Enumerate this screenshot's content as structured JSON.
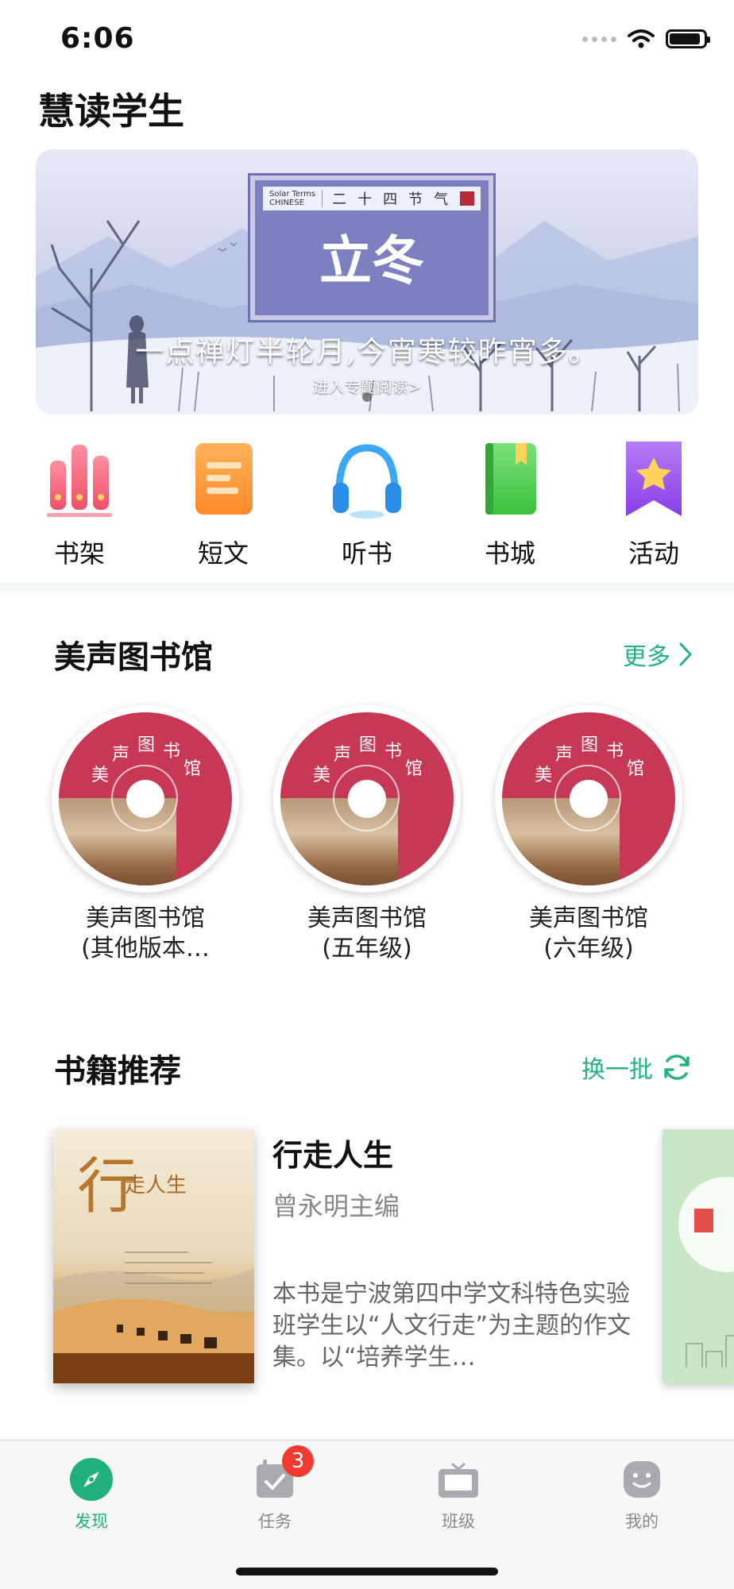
{
  "status_bar": {
    "time": "6:06"
  },
  "header": {
    "title": "慧读学生"
  },
  "banner": {
    "sign_en_line1": "Solar Terms",
    "sign_en_line2": "CHINESE",
    "sign_series": "二十四节气",
    "sign_title": "立冬",
    "poem": "一点禅灯半轮月,今宵寒较昨宵多。",
    "link": "进入专题阅读>"
  },
  "quick_nav": [
    {
      "label": "书架",
      "icon": "bookshelf-icon"
    },
    {
      "label": "短文",
      "icon": "article-icon"
    },
    {
      "label": "听书",
      "icon": "headphones-icon"
    },
    {
      "label": "书城",
      "icon": "bookstore-icon"
    },
    {
      "label": "活动",
      "icon": "activity-star-icon"
    }
  ],
  "library": {
    "title": "美声图书馆",
    "more": "更多",
    "disc_text": [
      "美",
      "声",
      "图",
      "书",
      "馆"
    ],
    "items": [
      {
        "line1": "美声图书馆",
        "line2": "(其他版本…"
      },
      {
        "line1": "美声图书馆",
        "line2": "(五年级)"
      },
      {
        "line1": "美声图书馆",
        "line2": "(六年级)"
      }
    ]
  },
  "recommend": {
    "title": "书籍推荐",
    "refresh": "换一批",
    "book": {
      "title": "行走人生",
      "author": "曾永明主编",
      "description": "本书是宁波第四中学文科特色实验班学生以“人文行走”为主题的作文集。以“培养学生…",
      "cover_title": "走人生",
      "cover_big_char": "行"
    }
  },
  "tabbar": {
    "tabs": [
      {
        "label": "发现",
        "icon": "compass-icon",
        "active": true
      },
      {
        "label": "任务",
        "icon": "task-calendar-icon",
        "badge": "3"
      },
      {
        "label": "班级",
        "icon": "class-board-icon"
      },
      {
        "label": "我的",
        "icon": "profile-smile-icon"
      }
    ]
  },
  "colors": {
    "accent": "#20b07a",
    "badge": "#f0392f",
    "disc": "#c73855"
  }
}
